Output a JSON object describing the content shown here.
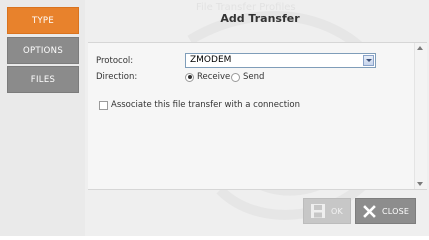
{
  "window": {
    "ghost_title": "File Transfer Profiles",
    "title": "Add Transfer"
  },
  "nav": {
    "items": [
      {
        "label": "TYPE",
        "active": true
      },
      {
        "label": "OPTIONS",
        "active": false
      },
      {
        "label": "FILES",
        "active": false
      }
    ]
  },
  "form": {
    "protocol_label": "Protocol:",
    "protocol_value": "ZMODEM",
    "direction_label": "Direction:",
    "direction_options": [
      {
        "label": "Receive",
        "selected": true
      },
      {
        "label": "Send",
        "selected": false
      }
    ],
    "associate_label": "Associate this file transfer with a connection",
    "associate_checked": false
  },
  "footer": {
    "ok_label": "OK",
    "close_label": "CLOSE"
  },
  "colors": {
    "accent": "#e8822c",
    "nav_inactive": "#8b8b8b",
    "background": "#efefef"
  },
  "icons": {
    "ok": "floppy-disk-icon",
    "close": "x-close-icon",
    "dropdown": "chevron-down-icon"
  }
}
